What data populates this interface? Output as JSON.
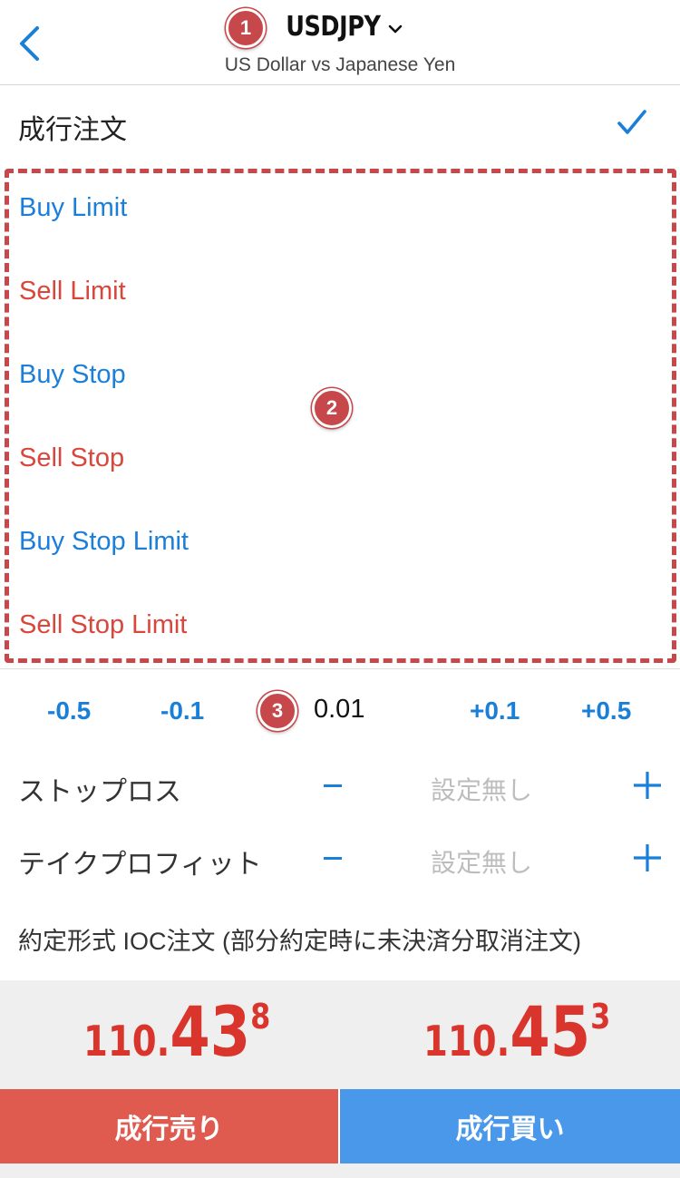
{
  "header": {
    "symbol": "USDJPY",
    "description": "US Dollar vs Japanese Yen"
  },
  "annotations": [
    "1",
    "2",
    "3"
  ],
  "market_order": {
    "label": "成行注文",
    "selected": true
  },
  "order_types": [
    {
      "label": "Buy Limit",
      "color": "#1a7fd8"
    },
    {
      "label": "Sell Limit",
      "color": "#d9473c"
    },
    {
      "label": "Buy Stop",
      "color": "#1a7fd8"
    },
    {
      "label": "Sell Stop",
      "color": "#d9473c"
    },
    {
      "label": "Buy Stop Limit",
      "color": "#1a7fd8"
    },
    {
      "label": "Sell Stop Limit",
      "color": "#d9473c"
    }
  ],
  "volume": {
    "steps_minus": [
      "-0.5",
      "-0.1"
    ],
    "value": "0.01",
    "steps_plus": [
      "+0.1",
      "+0.5"
    ]
  },
  "stop_loss": {
    "label": "ストップロス",
    "value": "設定無し"
  },
  "take_profit": {
    "label": "テイクプロフィット",
    "value": "設定無し"
  },
  "fill_policy": "約定形式 IOC注文 (部分約定時に未決済分取消注文)",
  "prices": {
    "sell": {
      "prefix": "110.",
      "big": "43",
      "pip": "8"
    },
    "buy": {
      "prefix": "110.",
      "big": "45",
      "pip": "3"
    }
  },
  "buttons": {
    "sell": "成行売り",
    "buy": "成行買い"
  },
  "colors": {
    "accent_blue": "#1a7fd8",
    "sell_red": "#d9473c",
    "badge": "#c6484a"
  }
}
